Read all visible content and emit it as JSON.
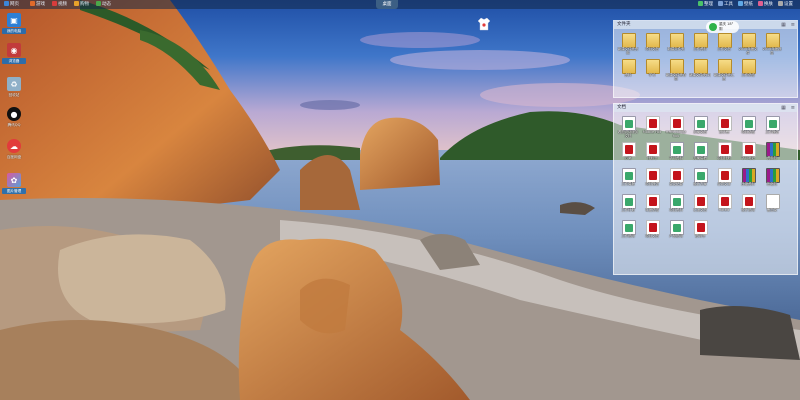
{
  "topbar": {
    "left_items": [
      {
        "label": "网页",
        "icon": "globe-icon",
        "color": "#3c86d8"
      },
      {
        "label": "游戏",
        "icon": "gamepad-icon",
        "color": "#e06a2a"
      },
      {
        "label": "视频",
        "icon": "video-icon",
        "color": "#d83c3c"
      },
      {
        "label": "购物",
        "icon": "bag-icon",
        "color": "#e8a22a"
      },
      {
        "label": "动态",
        "icon": "bell-icon",
        "color": "#4aa84a"
      }
    ],
    "center_label": "桌面",
    "right_items": [
      {
        "label": "整理",
        "icon": "broom-icon",
        "color": "#4bc26a"
      },
      {
        "label": "工具",
        "icon": "tools-icon",
        "color": "#7aa0d6"
      },
      {
        "label": "壁纸",
        "icon": "wallpaper-icon",
        "color": "#5fa8e6"
      },
      {
        "label": "换肤",
        "icon": "skin-icon",
        "color": "#e06090"
      },
      {
        "label": "设置",
        "icon": "gear-icon",
        "color": "#aaaaaa"
      }
    ]
  },
  "left_icons": [
    {
      "label": "我的电脑",
      "icon": "computer-icon",
      "color": "#2d7fd4",
      "selected": true
    },
    {
      "label": "浏览器",
      "icon": "browser-icon",
      "color": "#c23b3b",
      "selected": true
    },
    {
      "label": "回收站",
      "icon": "recycle-bin-icon",
      "color": "#8fb0c8",
      "selected": false
    },
    {
      "label": "腾讯QQ",
      "icon": "qq-penguin-icon",
      "color": "#111111",
      "selected": false
    },
    {
      "label": "百度网盘",
      "icon": "cloud-drive-icon",
      "color": "#e23b3b",
      "selected": false
    },
    {
      "label": "图片管理",
      "icon": "photo-icon",
      "color": "#d85aa0",
      "selected": true
    }
  ],
  "fence_files": {
    "title": "文件夹",
    "items": [
      {
        "label": "新建文件夹资料",
        "type": "folder"
      },
      {
        "label": "项目文档",
        "type": "folder"
      },
      {
        "label": "新建文件夹",
        "type": "folder"
      },
      {
        "label": "工作资料",
        "type": "folder"
      },
      {
        "label": "工作文档",
        "type": "folder"
      },
      {
        "label": "2015年度文件",
        "type": "folder"
      },
      {
        "label": "2015年度报告",
        "type": "folder"
      },
      {
        "label": "资料",
        "type": "folder"
      },
      {
        "label": "学习",
        "type": "folder"
      },
      {
        "label": "新建文件夹合同",
        "type": "folder"
      },
      {
        "label": "新建文件夹(2)",
        "type": "folder"
      },
      {
        "label": "新建文件夹汇总",
        "type": "folder"
      },
      {
        "label": "工作总结",
        "type": "folder"
      }
    ]
  },
  "fence_docs": {
    "title": "文档",
    "items": [
      {
        "label": "看图说话服务文档",
        "type": "docx"
      },
      {
        "label": "Mobile Hot",
        "type": "pdf"
      },
      {
        "label": "Hello Hangzhou",
        "type": "pdf"
      },
      {
        "label": "方案文档",
        "type": "docx"
      },
      {
        "label": "设计稿",
        "type": "pdf"
      },
      {
        "label": "项目总结",
        "type": "docx"
      },
      {
        "label": "工作报告",
        "type": "docx"
      },
      {
        "label": "方案",
        "type": "pdf"
      },
      {
        "label": "计划书",
        "type": "pdf"
      },
      {
        "label": "学习资料",
        "type": "docx"
      },
      {
        "label": "方案讲稿",
        "type": "docx"
      },
      {
        "label": "项目计划",
        "type": "pdf"
      },
      {
        "label": "学习笔记",
        "type": "pdf"
      },
      {
        "label": "资料包",
        "type": "rar"
      },
      {
        "label": "工作周报",
        "type": "docx"
      },
      {
        "label": "项目报告",
        "type": "pdf"
      },
      {
        "label": "会议纪要",
        "type": "pdf"
      },
      {
        "label": "设计方案",
        "type": "docx"
      },
      {
        "label": "合同文本",
        "type": "pdf"
      },
      {
        "label": "压缩资料",
        "type": "rar"
      },
      {
        "label": "压缩包",
        "type": "rar"
      },
      {
        "label": "工作计划",
        "type": "docx"
      },
      {
        "label": "年度总结",
        "type": "pdf"
      },
      {
        "label": "项目资料",
        "type": "docx"
      },
      {
        "label": "汇报文档",
        "type": "pdf"
      },
      {
        "label": "Hotels",
        "type": "pdf"
      },
      {
        "label": "设计说明",
        "type": "pdf"
      },
      {
        "label": "备忘录",
        "type": "blank"
      },
      {
        "label": "工作说明",
        "type": "docx"
      },
      {
        "label": "项目文档",
        "type": "pdf"
      },
      {
        "label": "产品说明",
        "type": "docx"
      },
      {
        "label": "说明书",
        "type": "pdf"
      }
    ]
  },
  "weather": {
    "line1": "重庆 18°",
    "line2": "阴"
  }
}
